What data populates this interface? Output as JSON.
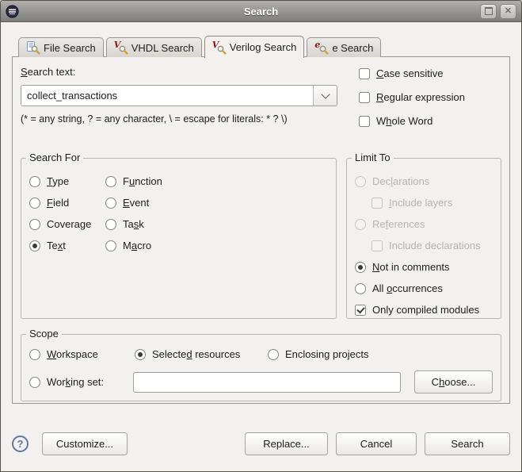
{
  "window": {
    "title": "Search"
  },
  "icons": {
    "close": "✕",
    "help": "?"
  },
  "colors": {
    "dialog_bg": "#f2f1f0",
    "titlebar_top": "#b0afae",
    "titlebar_bottom": "#7e7d7b",
    "tab_letter_red": "#8b1a18",
    "magnifier_handle_gold": "#c8a23e",
    "help_blue": "#64779f",
    "disabled_text": "#b7b3ae"
  },
  "tabs": [
    {
      "label": "File Search",
      "active": false
    },
    {
      "label": "VHDL Search",
      "letter": "V",
      "active": false
    },
    {
      "label": "Verilog Search",
      "letter": "V",
      "active": true
    },
    {
      "label": "e Search",
      "letter": "e",
      "active": false
    }
  ],
  "search_text": {
    "label": {
      "pre": "",
      "key": "S",
      "post": "earch text:"
    },
    "value": "collect_transactions",
    "hint": "(* = any string, ? = any character, \\ = escape for literals: * ? \\)"
  },
  "options": [
    {
      "pre": "",
      "key": "C",
      "post": "ase sensitive",
      "checked": false
    },
    {
      "pre": "",
      "key": "R",
      "post": "egular expression",
      "checked": false
    },
    {
      "pre": "W",
      "key": "h",
      "post": "ole Word",
      "checked": false
    }
  ],
  "search_for": {
    "title": "Search For",
    "col1": [
      {
        "pre": "",
        "key": "T",
        "post": "ype",
        "selected": false
      },
      {
        "pre": "",
        "key": "F",
        "post": "ield",
        "selected": false
      },
      {
        "pre": "Coverage",
        "key": "",
        "post": "",
        "selected": false
      },
      {
        "pre": "Te",
        "key": "x",
        "post": "t",
        "selected": true
      }
    ],
    "col2": [
      {
        "pre": "F",
        "key": "u",
        "post": "nction",
        "selected": false
      },
      {
        "pre": "",
        "key": "E",
        "post": "vent",
        "selected": false
      },
      {
        "pre": "Ta",
        "key": "s",
        "post": "k",
        "selected": false
      },
      {
        "pre": "M",
        "key": "a",
        "post": "cro",
        "selected": false
      }
    ]
  },
  "limit_to": {
    "title": "Limit To",
    "items": [
      {
        "pre": "Dec",
        "key": "l",
        "post": "arations",
        "type": "radio",
        "disabled": true,
        "selected": false,
        "indent": false
      },
      {
        "pre": "",
        "key": "I",
        "post": "nclude layers",
        "type": "checkbox",
        "disabled": true,
        "checked": false,
        "indent": true
      },
      {
        "pre": "Re",
        "key": "f",
        "post": "erences",
        "type": "radio",
        "disabled": true,
        "selected": false,
        "indent": false
      },
      {
        "pre": "Include declarations",
        "key": "",
        "post": "",
        "type": "checkbox",
        "disabled": true,
        "checked": false,
        "indent": true
      },
      {
        "pre": "",
        "key": "N",
        "post": "ot in comments",
        "type": "radio",
        "disabled": false,
        "selected": true,
        "indent": false
      },
      {
        "pre": "All ",
        "key": "o",
        "post": "ccurrences",
        "type": "radio",
        "disabled": false,
        "selected": false,
        "indent": false
      },
      {
        "pre": "Only compiled modules",
        "key": "",
        "post": "",
        "type": "checkbox",
        "disabled": false,
        "checked": true,
        "indent": false
      }
    ]
  },
  "scope": {
    "title": "Scope",
    "workspace": {
      "pre": "",
      "key": "W",
      "post": "orkspace",
      "selected": false
    },
    "selected_resources": {
      "pre": "Selecte",
      "key": "d",
      "post": " resources",
      "selected": true
    },
    "enclosing_projects": {
      "pre": "Enclosing projects",
      "key": "",
      "post": "",
      "selected": false
    },
    "working_set": {
      "pre": "Wor",
      "key": "k",
      "post": "ing set:",
      "selected": false
    },
    "working_set_value": "",
    "choose_button": {
      "pre": "C",
      "key": "h",
      "post": "oose..."
    }
  },
  "footer": {
    "customize": "Customize...",
    "replace": "Replace...",
    "cancel": "Cancel",
    "search": "Search"
  }
}
